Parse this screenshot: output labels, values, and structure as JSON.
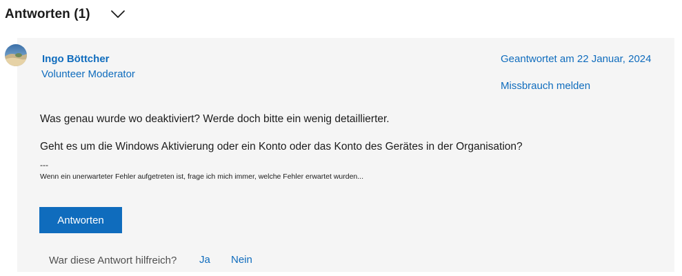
{
  "answers": {
    "title": "Antworten (1)",
    "toggle_icon": "chevron-down-icon"
  },
  "answer": {
    "author_name": "Ingo Böttcher",
    "author_role": "Volunteer Moderator",
    "answered_date": "Geantwortet am 22 Januar, 2024",
    "report_label": "Missbrauch melden",
    "body": {
      "line1": "Was genau wurde wo deaktiviert? Werde doch bitte ein wenig detaillierter.",
      "line2": "Geht es um die Windows Aktivierung oder ein Konto oder das Konto des Gerätes in der Organisation?"
    },
    "signature": {
      "separator": "---",
      "text": "Wenn ein unerwarteter Fehler aufgetreten ist, frage ich mich immer, welche Fehler erwartet wurden..."
    },
    "reply_label": "Antworten",
    "helpful": {
      "question": "War diese Antwort hilfreich?",
      "yes": "Ja",
      "no": "Nein"
    }
  },
  "colors": {
    "link": "#0f6cbd",
    "button_bg": "#0f6cbd",
    "card_bg": "#f5f5f5",
    "text": "#1b1b1b"
  }
}
